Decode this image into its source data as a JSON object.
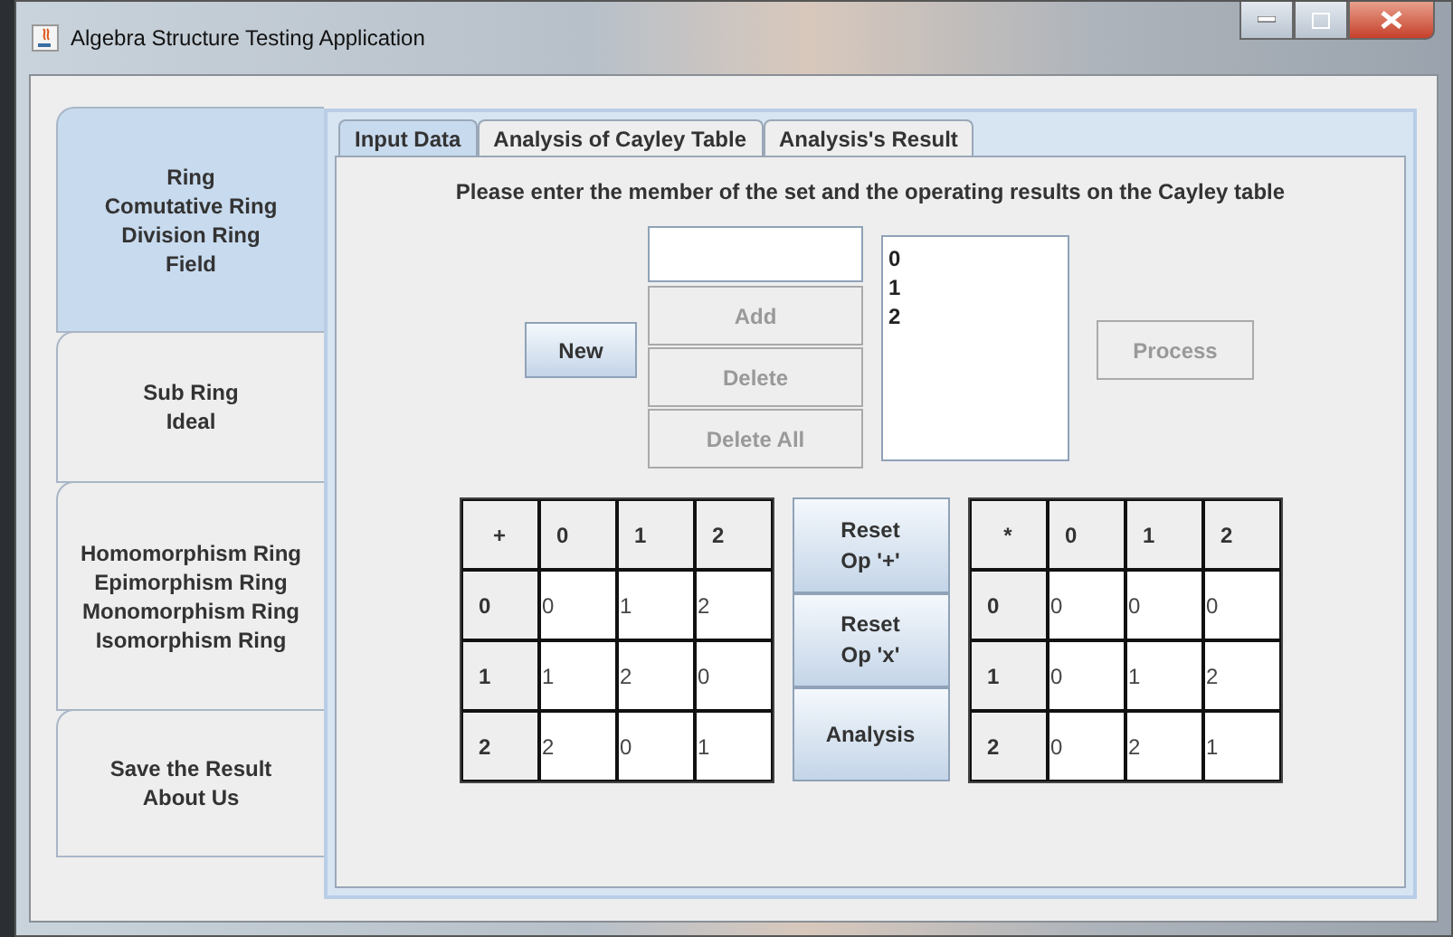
{
  "window": {
    "title": "Algebra Structure Testing Application"
  },
  "side_tabs": [
    {
      "lines": [
        "Ring",
        "Comutative Ring",
        "Division Ring",
        "Field"
      ],
      "selected": true
    },
    {
      "lines": [
        "Sub Ring",
        "Ideal"
      ],
      "selected": false
    },
    {
      "lines": [
        "Homomorphism Ring",
        "Epimorphism Ring",
        "Monomorphism Ring",
        "Isomorphism Ring"
      ],
      "selected": false
    },
    {
      "lines": [
        "Save the Result",
        "About Us"
      ],
      "selected": false
    }
  ],
  "tabs": [
    {
      "label": "Input Data",
      "selected": true
    },
    {
      "label": "Analysis of Cayley Table",
      "selected": false
    },
    {
      "label": "Analysis's Result",
      "selected": false
    }
  ],
  "instruction": "Please enter the member of the set and the operating results on the Cayley table",
  "new_button": {
    "label": "New",
    "disabled": false
  },
  "edit_buttons": [
    {
      "label": "Add",
      "disabled": true
    },
    {
      "label": "Delete",
      "disabled": true
    },
    {
      "label": "Delete All",
      "disabled": true
    }
  ],
  "members": [
    "0",
    "1",
    "2"
  ],
  "process_button": {
    "label": "Process",
    "disabled": true
  },
  "tables": [
    {
      "operator": "+",
      "columns": [
        "0",
        "1",
        "2"
      ],
      "rows": [
        {
          "head": "0",
          "cells": [
            "0",
            "1",
            "2"
          ]
        },
        {
          "head": "1",
          "cells": [
            "1",
            "2",
            "0"
          ]
        },
        {
          "head": "2",
          "cells": [
            "2",
            "0",
            "1"
          ]
        }
      ]
    },
    {
      "operator": "*",
      "columns": [
        "0",
        "1",
        "2"
      ],
      "rows": [
        {
          "head": "0",
          "cells": [
            "0",
            "0",
            "0"
          ]
        },
        {
          "head": "1",
          "cells": [
            "0",
            "1",
            "2"
          ]
        },
        {
          "head": "2",
          "cells": [
            "0",
            "2",
            "1"
          ]
        }
      ]
    }
  ],
  "middle_buttons": [
    {
      "lines": [
        "Reset",
        "Op '+'"
      ]
    },
    {
      "lines": [
        "Reset",
        "Op 'x'"
      ]
    },
    {
      "lines": [
        "Analysis"
      ]
    }
  ]
}
